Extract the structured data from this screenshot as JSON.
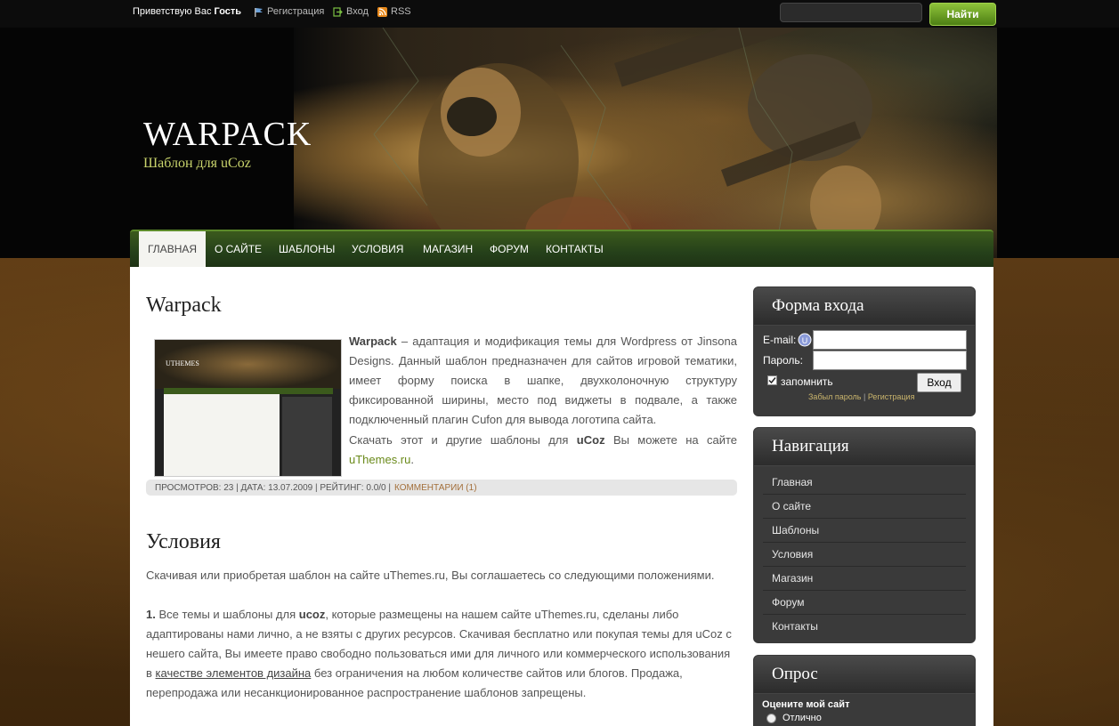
{
  "topbar": {
    "greeting_prefix": "Приветствую Вас",
    "greeting_user": "Гость",
    "register_label": "Регистрация",
    "login_label": "Вход",
    "rss_label": "RSS",
    "search_button_label": "Найти"
  },
  "header": {
    "title": "WARPACK",
    "subtitle": "Шаблон для uCoz"
  },
  "nav": {
    "items": [
      {
        "label": "ГЛАВНАЯ",
        "active": true
      },
      {
        "label": "О САЙТЕ",
        "active": false
      },
      {
        "label": "ШАБЛОНЫ",
        "active": false
      },
      {
        "label": "УСЛОВИЯ",
        "active": false
      },
      {
        "label": "МАГАЗИН",
        "active": false
      },
      {
        "label": "ФОРУМ",
        "active": false
      },
      {
        "label": "КОНТАКТЫ",
        "active": false
      }
    ]
  },
  "post": {
    "title": "Warpack",
    "thumb_title": "UTHEMES",
    "bold_name": "Warpack",
    "text1": "– адаптация и модификация темы для Wordpress от Jinsona Designs. Данный шаблон предназначен для сайтов игровой тематики, имеет форму поиска в шапке, двухколоночную структуру фиксированной ширины, место под виджеты в подвале, а также подключенный плагин Cufon для вывода логотипа сайта.",
    "text2_a": "Скачать этот и другие шаблоны для",
    "text2_b": "uCoz",
    "text2_c": "Вы можете на сайте",
    "link": "uThemes.ru",
    "link_dot": ".",
    "meta": "ПРОСМОТРОВ: 23 | ДАТА: 13.07.2009 | РЕЙТИНГ: 0.0/0 |",
    "comments": "КОММЕНТАРИИ (1)"
  },
  "terms": {
    "title": "Условия",
    "intro": "Скачивая или приобретая шаблон на сайте uThemes.ru, Вы соглашаетесь со следующими положениями.",
    "p1_num": "1.",
    "p1_a": "Все темы и шаблоны для",
    "p1_b": "ucoz",
    "p1_c": ", которые размещены на нашем сайте uThemes.ru, сделаны либо адаптированы нами лично, а не взяты с других ресурсов. Скачивая бесплатно или покупая темы для uCoz с нешего сайта, Вы имеете право свободно пользоваться ими для личного или коммерческого использования в",
    "p1_link": "качестве элементов дизайна",
    "p1_d": "без ограничения на любом количестве сайтов или блогов. Продажа, перепродажа или несанкционированное распространение шаблонов запрещены."
  },
  "login": {
    "title": "Форма входа",
    "email_label": "E-mail:",
    "password_label": "Пароль:",
    "remember_label": "запомнить",
    "button_label": "Вход",
    "forgot_label": "Забыл пароль",
    "sep": "|",
    "register_label": "Регистрация"
  },
  "sidenav": {
    "title": "Навигация",
    "items": [
      "Главная",
      "О сайте",
      "Шаблоны",
      "Условия",
      "Магазин",
      "Форум",
      "Контакты"
    ]
  },
  "poll": {
    "title": "Опрос",
    "question": "Оцените мой сайт",
    "option1": "Отлично"
  },
  "colors": {
    "accent_green": "#4d7f14",
    "nav_green": "#25401a",
    "link_green": "#6a8a1a",
    "subtitle_yellow": "#c9d46c"
  }
}
